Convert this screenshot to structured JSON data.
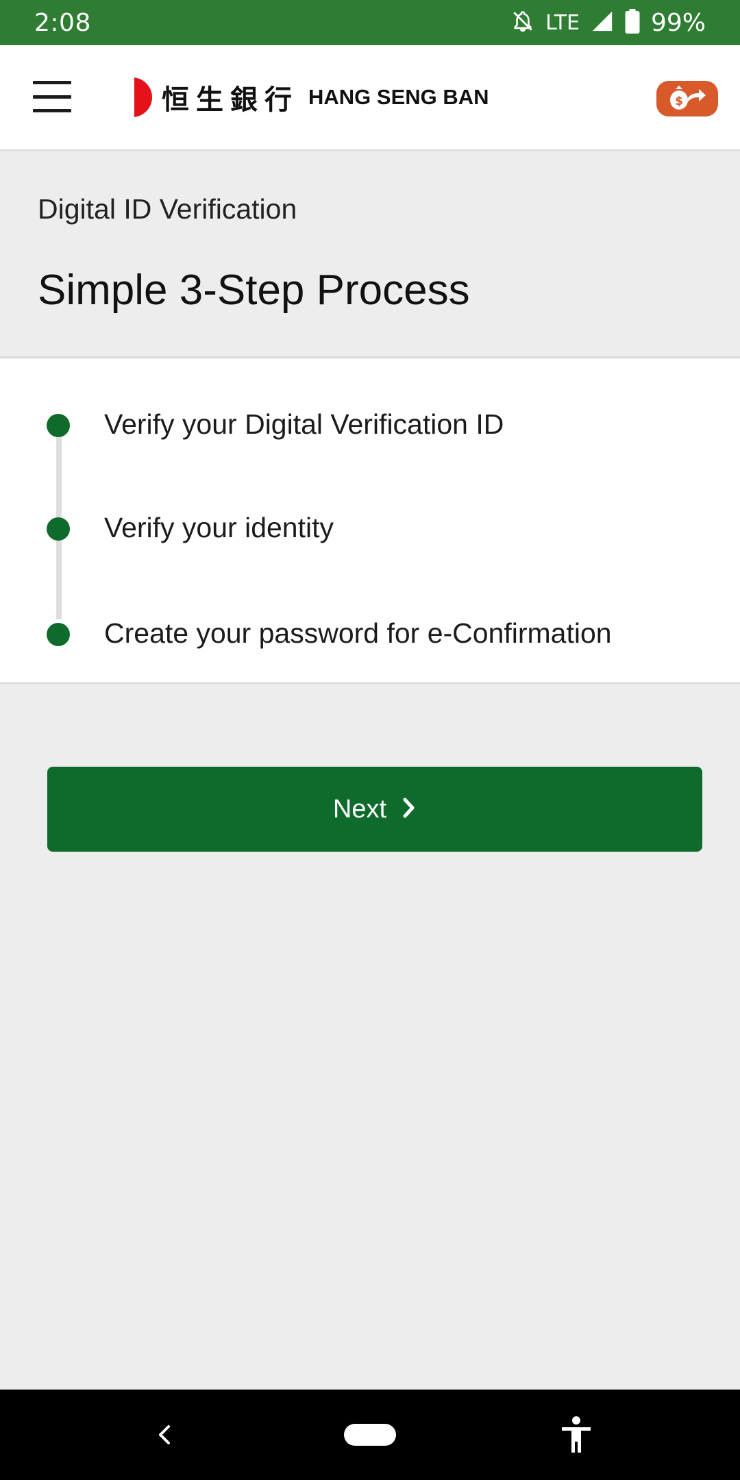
{
  "status_bar": {
    "time": "2:08",
    "network": "LTE",
    "battery": "99%",
    "icons": [
      "notifications-off-icon",
      "signal-icon",
      "battery-icon"
    ]
  },
  "header": {
    "menu_icon": "hamburger-menu-icon",
    "logo": {
      "chinese": "恒生銀行",
      "english": "HANG SENG BAN"
    },
    "transfer_icon": "money-bag-transfer-icon",
    "colors": {
      "logo_red": "#e3121b",
      "transfer_button": "#d85a2a"
    }
  },
  "page": {
    "subtitle": "Digital ID Verification",
    "title": "Simple 3-Step Process"
  },
  "steps": [
    {
      "label": "Verify your Digital Verification ID"
    },
    {
      "label": "Verify your identity"
    },
    {
      "label": "Create your password for e-Confirmation"
    }
  ],
  "actions": {
    "next_label": "Next",
    "next_icon": "chevron-right-icon"
  },
  "nav_bar": {
    "icons": [
      "back-icon",
      "home-pill-icon",
      "accessibility-icon"
    ]
  },
  "colors": {
    "status_bar": "#2e7d32",
    "primary_green": "#0f6b2c",
    "background": "#ededed"
  }
}
